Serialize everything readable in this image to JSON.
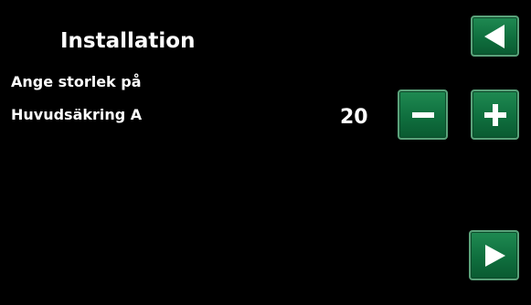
{
  "header": {
    "title": "Installation"
  },
  "setting": {
    "label_line1": "Ange storlek på",
    "label_line2": "Huvudsäkring A",
    "value": "20"
  },
  "buttons": {
    "back_icon": "triangle-left-icon",
    "minus_icon": "minus-icon",
    "plus_icon": "plus-icon",
    "next_icon": "triangle-right-icon"
  },
  "colors": {
    "background": "#000000",
    "button_green": "#0f6f3e",
    "button_border": "#5aa27a",
    "text": "#ffffff"
  }
}
